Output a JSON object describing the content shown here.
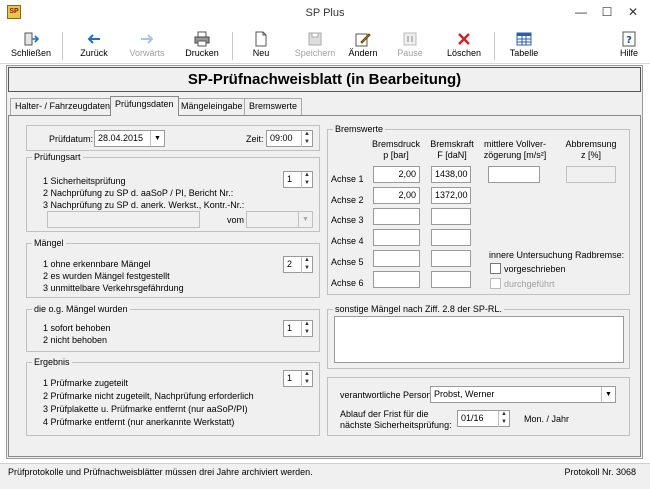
{
  "window": {
    "title": "SP Plus",
    "minimize": "—",
    "maximize": "☐",
    "close": "✕"
  },
  "toolbar": [
    {
      "label": "Schließen",
      "icon": "exit-icon",
      "enabled": true
    },
    {
      "label": "Zurück",
      "icon": "arrow-left-icon",
      "enabled": true
    },
    {
      "label": "Vorwärts",
      "icon": "arrow-right-icon",
      "enabled": false
    },
    {
      "label": "Drucken",
      "icon": "printer-icon",
      "enabled": true
    },
    {
      "label": "Neu",
      "icon": "new-document-icon",
      "enabled": true
    },
    {
      "label": "Speichern",
      "icon": "save-disk-icon",
      "enabled": false
    },
    {
      "label": "Ändern",
      "icon": "edit-pencil-icon",
      "enabled": true
    },
    {
      "label": "Pause",
      "icon": "pause-icon",
      "enabled": false
    },
    {
      "label": "Löschen",
      "icon": "delete-x-icon",
      "enabled": true
    },
    {
      "label": "Tabelle",
      "icon": "table-icon",
      "enabled": true
    },
    {
      "label": "Hilfe",
      "icon": "help-icon",
      "enabled": true
    }
  ],
  "heading": "SP-Prüfnachweisblatt (in Bearbeitung)",
  "tabs": [
    "Halter- / Fahrzeugdaten",
    "Prüfungsdaten",
    "Mängeleingabe",
    "Bremswerte"
  ],
  "active_tab": "Prüfungsdaten",
  "pruefdatum": {
    "label": "Prüfdatum:",
    "value": "28.04.2015",
    "time_label": "Zeit:",
    "time_value": "09:00"
  },
  "pruefungsart": {
    "title": "Prüfungsart",
    "options": [
      "1 Sicherheitsprüfung",
      "2 Nachprüfung zu SP d. aaSoP / PI, Bericht Nr.:",
      "3 Nachprüfung zu SP d. anerk. Werkst., Kontr.-Nr.:"
    ],
    "value": "1",
    "vom_label": "vom"
  },
  "maengel": {
    "title": "Mängel",
    "options": [
      "1 ohne erkennbare Mängel",
      "2 es wurden Mängel festgestellt",
      "3 unmittelbare Verkehrsgefährdung"
    ],
    "value": "2"
  },
  "behoben": {
    "title": "die o.g. Mängel wurden",
    "options": [
      "1 sofort behoben",
      "2 nicht behoben"
    ],
    "value": "1"
  },
  "ergebnis": {
    "title": "Ergebnis",
    "options": [
      "1 Prüfmarke zugeteilt",
      "2 Prüfmarke nicht zugeteilt, Nachprüfung erforderlich",
      "3 Prüfplakette u. Prüfmarke entfernt (nur aaSoP/PI)",
      "4 Prüfmarke entfernt (nur anerkannte Werkstatt)"
    ],
    "value": "1"
  },
  "bremswerte": {
    "title": "Bremswerte",
    "col_druck": [
      "Bremsdruck",
      "p [bar]"
    ],
    "col_kraft": [
      "Bremskraft",
      "F [daN]"
    ],
    "col_verz": [
      "mittlere Vollver-",
      "zögerung [m/s²]"
    ],
    "col_abbr": [
      "Abbremsung",
      "z [%]"
    ],
    "achsen": [
      {
        "label": "Achse 1",
        "druck": "2,00",
        "kraft": "1438,00"
      },
      {
        "label": "Achse 2",
        "druck": "2,00",
        "kraft": "1372,00"
      },
      {
        "label": "Achse 3",
        "druck": "",
        "kraft": ""
      },
      {
        "label": "Achse 4",
        "druck": "",
        "kraft": ""
      },
      {
        "label": "Achse 5",
        "druck": "",
        "kraft": ""
      },
      {
        "label": "Achse 6",
        "druck": "",
        "kraft": ""
      }
    ],
    "innere_label": "innere Untersuchung Radbremse:",
    "vorgeschrieben": "vorgeschrieben",
    "durchgefuehrt": "durchgeführt"
  },
  "sonstige": {
    "title": "sonstige Mängel nach Ziff. 2.8 der SP-RL."
  },
  "person": {
    "label": "verantwortliche Person:",
    "value": "Probst, Werner"
  },
  "frist": {
    "label1": "Ablauf der Frist für die",
    "label2": "nächste Sicherheitsprüfung:",
    "value": "01/16",
    "unit": "Mon. / Jahr"
  },
  "status": {
    "left": "Prüfprotokolle und Prüfnachweisblätter müssen drei Jahre archiviert werden.",
    "right": "Protokoll Nr. 3068"
  }
}
